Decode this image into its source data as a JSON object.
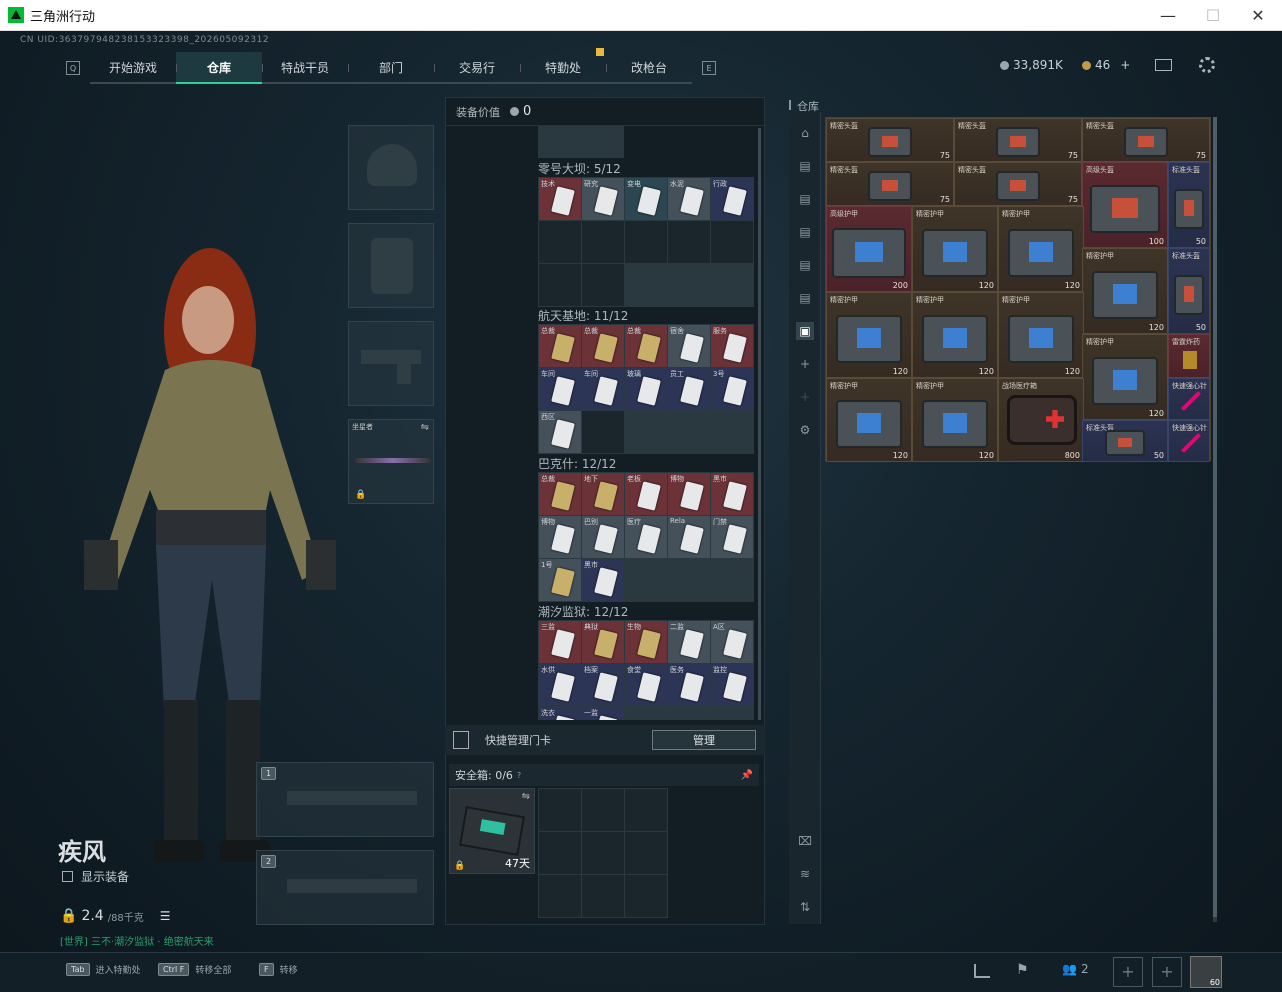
{
  "window": {
    "title": "三角洲行动",
    "min": "—",
    "max": "☐",
    "close": "✕"
  },
  "uid": "CN UID:363797948238153323398_202605092312",
  "nav": {
    "tabs": [
      "开始游戏",
      "仓库",
      "特战干员",
      "部门",
      "交易行",
      "特勤处",
      "改枪台"
    ],
    "active_index": 1,
    "left_key": "Q",
    "right_key": "E"
  },
  "resources": {
    "silver": "33,891K",
    "gold": "46",
    "plus": "+"
  },
  "colors": {
    "accent": "#2fd39a",
    "panel": "#121d24",
    "stash_bg": "#3c3024"
  },
  "operator": {
    "name": "疾风",
    "show_equipment": "显示装备",
    "weight": "2.4",
    "weight_max": "/88千克",
    "footer": "[世界] 三不·潮汐监狱 · 绝密航天来"
  },
  "slots": {
    "melee_label": "坐星者",
    "weapon1": "1",
    "weapon2": "2"
  },
  "mid": {
    "title": "装备价值",
    "value": "0",
    "groups": [
      {
        "name": "零号大坝: 5/12",
        "labels": [
          "技术",
          "研究",
          "变电",
          "水泥",
          "行政"
        ]
      },
      {
        "name": "航天基地: 11/12",
        "labels": [
          "总裁",
          "总裁",
          "总裁",
          "宿舍",
          "服务",
          "车间",
          "车间",
          "玻璃",
          "员工",
          "3号",
          "西区"
        ]
      },
      {
        "name": "巴克什: 12/12",
        "labels": [
          "总裁",
          "地下",
          "老板",
          "博物",
          "黑市",
          "博物",
          "巴别",
          "医疗",
          "Rela",
          "门禁",
          "1号",
          "黑市"
        ]
      },
      {
        "name": "潮汐监狱: 12/12",
        "labels": [
          "三监",
          "典狱",
          "生物",
          "二监",
          "A区",
          "水供",
          "档案",
          "食堂",
          "医务",
          "监控",
          "洗衣",
          "一监"
        ]
      }
    ],
    "quick_label": "快捷管理门卡",
    "manage_button": "管理",
    "safe_label": "安全箱: 0/6",
    "safe_help": "?",
    "safe_time": "47天"
  },
  "stash": {
    "title": "仓库",
    "items": [
      {
        "name": "精密头盔",
        "value": "75"
      },
      {
        "name": "精密头盔",
        "value": "75"
      },
      {
        "name": "精密头盔",
        "value": "75"
      },
      {
        "name": "精密头盔",
        "value": "75"
      },
      {
        "name": "精密头盔",
        "value": "75"
      },
      {
        "name": "高级头盔",
        "value": "100"
      },
      {
        "name": "标准头盔",
        "value": "50"
      },
      {
        "name": "高级护甲",
        "value": "200"
      },
      {
        "name": "精密护甲",
        "value": "120"
      },
      {
        "name": "精密护甲",
        "value": "120"
      },
      {
        "name": "精密护甲",
        "value": "120"
      },
      {
        "name": "标准头盔",
        "value": "50"
      },
      {
        "name": "精密护甲",
        "value": "120"
      },
      {
        "name": "精密护甲",
        "value": "120"
      },
      {
        "name": "精密护甲",
        "value": "120"
      },
      {
        "name": "精密护甲",
        "value": "120"
      },
      {
        "name": "雷霆炸药",
        "value": ""
      },
      {
        "name": "精密护甲",
        "value": "120"
      },
      {
        "name": "精密护甲",
        "value": "120"
      },
      {
        "name": "战场医疗箱",
        "value": "800"
      },
      {
        "name": "标准头盔",
        "value": "50"
      },
      {
        "name": "快速强心针",
        "value": ""
      },
      {
        "name": "快速强心针",
        "value": ""
      }
    ]
  },
  "hotkeys": [
    {
      "key": "Tab",
      "label": "进入特勤处"
    },
    {
      "key": "Ctrl F",
      "label": "转移全部"
    },
    {
      "key": "F",
      "label": "转移"
    }
  ],
  "bottom": {
    "friends": "2",
    "avatar_level": "60"
  }
}
